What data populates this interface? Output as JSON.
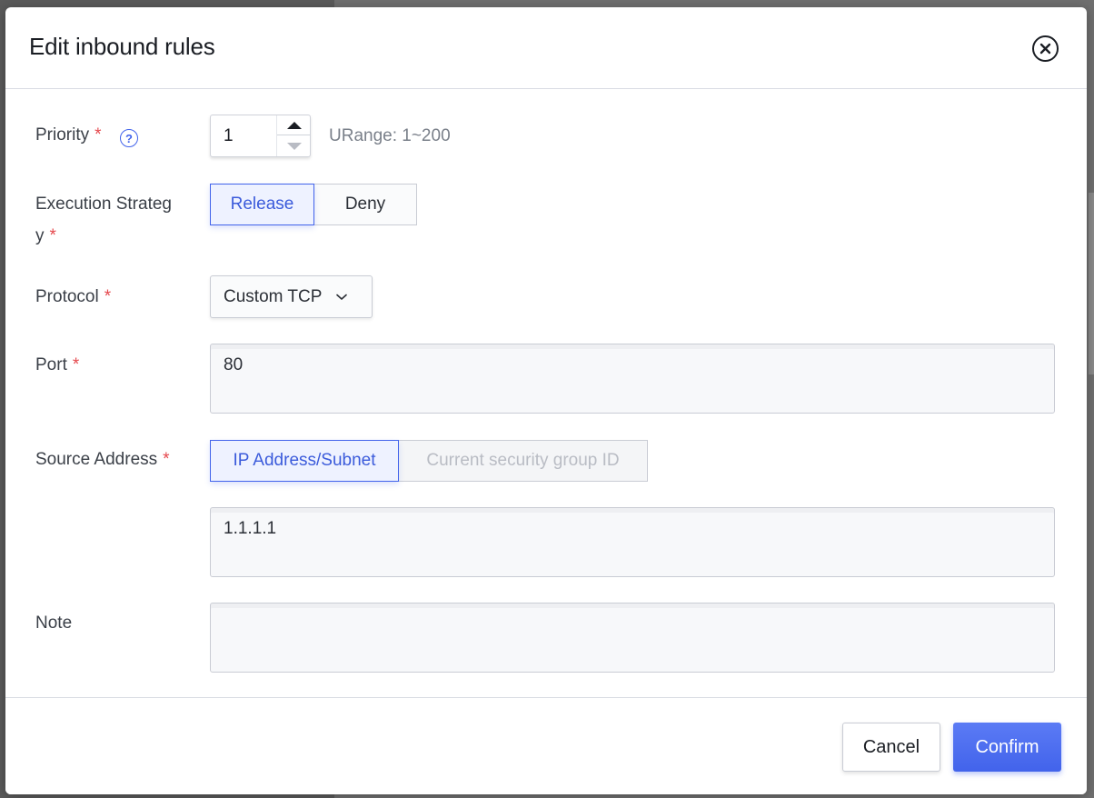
{
  "dialog": {
    "title": "Edit inbound rules",
    "close_icon": "close-circle-icon"
  },
  "priority": {
    "label": "Priority",
    "required_mark": "*",
    "help_icon": "question-circle-icon",
    "help_glyph": "?",
    "value": "1",
    "hint": "URange: 1~200"
  },
  "execution_strategy": {
    "label_line1": "Execution Strateg",
    "label_line2": "y",
    "required_mark": "*",
    "options": [
      "Release",
      "Deny"
    ],
    "selected": "Release"
  },
  "protocol": {
    "label": "Protocol",
    "required_mark": "*",
    "value": "Custom TCP",
    "chevron_icon": "chevron-down-icon"
  },
  "port": {
    "label": "Port",
    "required_mark": "*",
    "value": "80"
  },
  "source_address": {
    "label": "Source Address",
    "required_mark": "*",
    "options": [
      "IP Address/Subnet",
      "Current security group ID"
    ],
    "selected": "IP Address/Subnet",
    "value": "1.1.1.1"
  },
  "note": {
    "label": "Note",
    "value": ""
  },
  "footer": {
    "cancel_label": "Cancel",
    "confirm_label": "Confirm"
  },
  "colors": {
    "accent": "#4263eb",
    "required": "#e5484d"
  }
}
